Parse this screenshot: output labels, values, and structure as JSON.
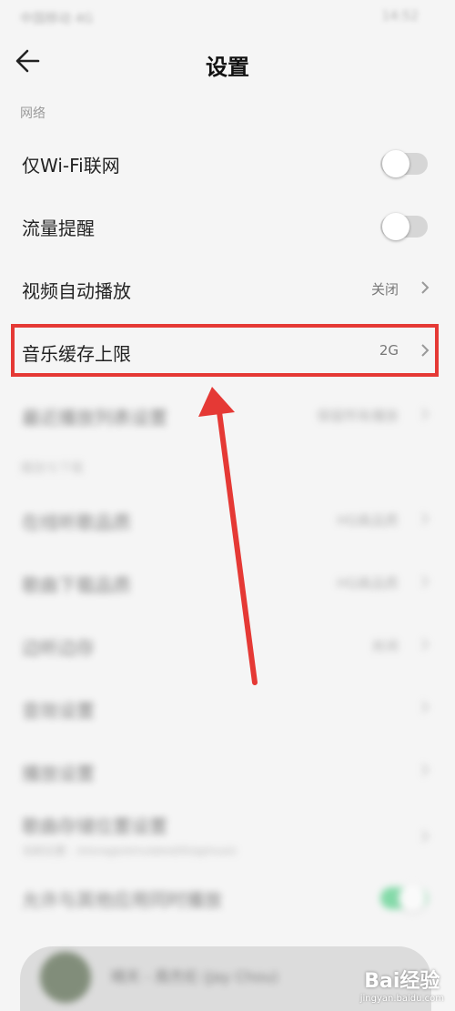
{
  "status_bar": {
    "left": "中国移动 4G",
    "right": "14:52"
  },
  "header": {
    "title": "设置"
  },
  "sections": {
    "network": "网络",
    "play_download": "播放与下载"
  },
  "rows": {
    "wifi_only": {
      "label": "仅Wi-Fi联网",
      "on": false
    },
    "data_alert": {
      "label": "流量提醒",
      "on": false
    },
    "video_autoplay": {
      "label": "视频自动播放",
      "value": "关闭"
    },
    "music_cache": {
      "label": "音乐缓存上限",
      "value": "2G"
    },
    "recent_list": {
      "label": "最近播放列表设置",
      "value": "保留所有播放"
    },
    "online_quality": {
      "label": "在线听歌品质",
      "value": "HQ高品质"
    },
    "download_quality": {
      "label": "歌曲下载品质",
      "value": "HQ高品质"
    },
    "sleep": {
      "label": "边听边存",
      "value": "关闭"
    },
    "sound": {
      "label": "音效设置"
    },
    "playback": {
      "label": "播放设置"
    },
    "storage": {
      "label": "歌曲存储位置设置",
      "sub": "当前位置：/storage/emulated/0/qqmusic"
    },
    "mix": {
      "label": "允许与其他应用同时播放",
      "on": true
    }
  },
  "player": {
    "song": "晴天 - 周杰伦 (Jay Chou)"
  },
  "watermark": {
    "brand": "Bai经验",
    "url": "jingyan.baidu.com"
  },
  "colors": {
    "highlight": "#e53935",
    "toggle_on": "#27c46a"
  }
}
